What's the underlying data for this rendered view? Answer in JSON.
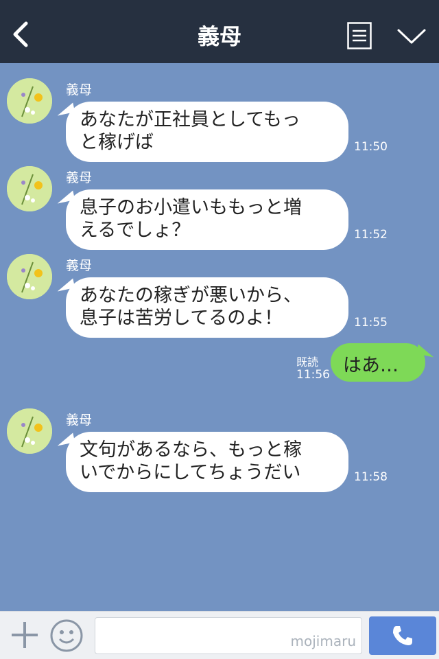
{
  "header": {
    "title": "義母",
    "colors": {
      "header_bg": "#263040",
      "chat_bg": "#7393c2",
      "my_bubble": "#7ed957"
    }
  },
  "messages": [
    {
      "sender": "義母",
      "lines": [
        "あなたが正社員としてもっ",
        "と稼げば"
      ],
      "time": "11:50"
    },
    {
      "sender": "義母",
      "lines": [
        "息子のお小遣いももっと増",
        "えるでしょ？"
      ],
      "time": "11:52"
    },
    {
      "sender": "義母",
      "lines": [
        "あなたの稼ぎが悪いから、",
        "息子は苦労してるのよ！"
      ],
      "time": "11:55"
    },
    {
      "sender": "義母",
      "lines": [
        "文句があるなら、もっと稼",
        "いでからにしてちょうだい"
      ],
      "time": "11:58"
    }
  ],
  "my_message": {
    "text": "はあ…",
    "read": "既読",
    "time": "11:56"
  },
  "input": {
    "watermark": "mojimaru"
  },
  "icons": {
    "back": "chevron-left-icon",
    "menu": "menu-icon",
    "dropdown": "chevron-down-icon",
    "plus": "plus-icon",
    "emoji": "smile-icon",
    "call": "phone-icon"
  }
}
